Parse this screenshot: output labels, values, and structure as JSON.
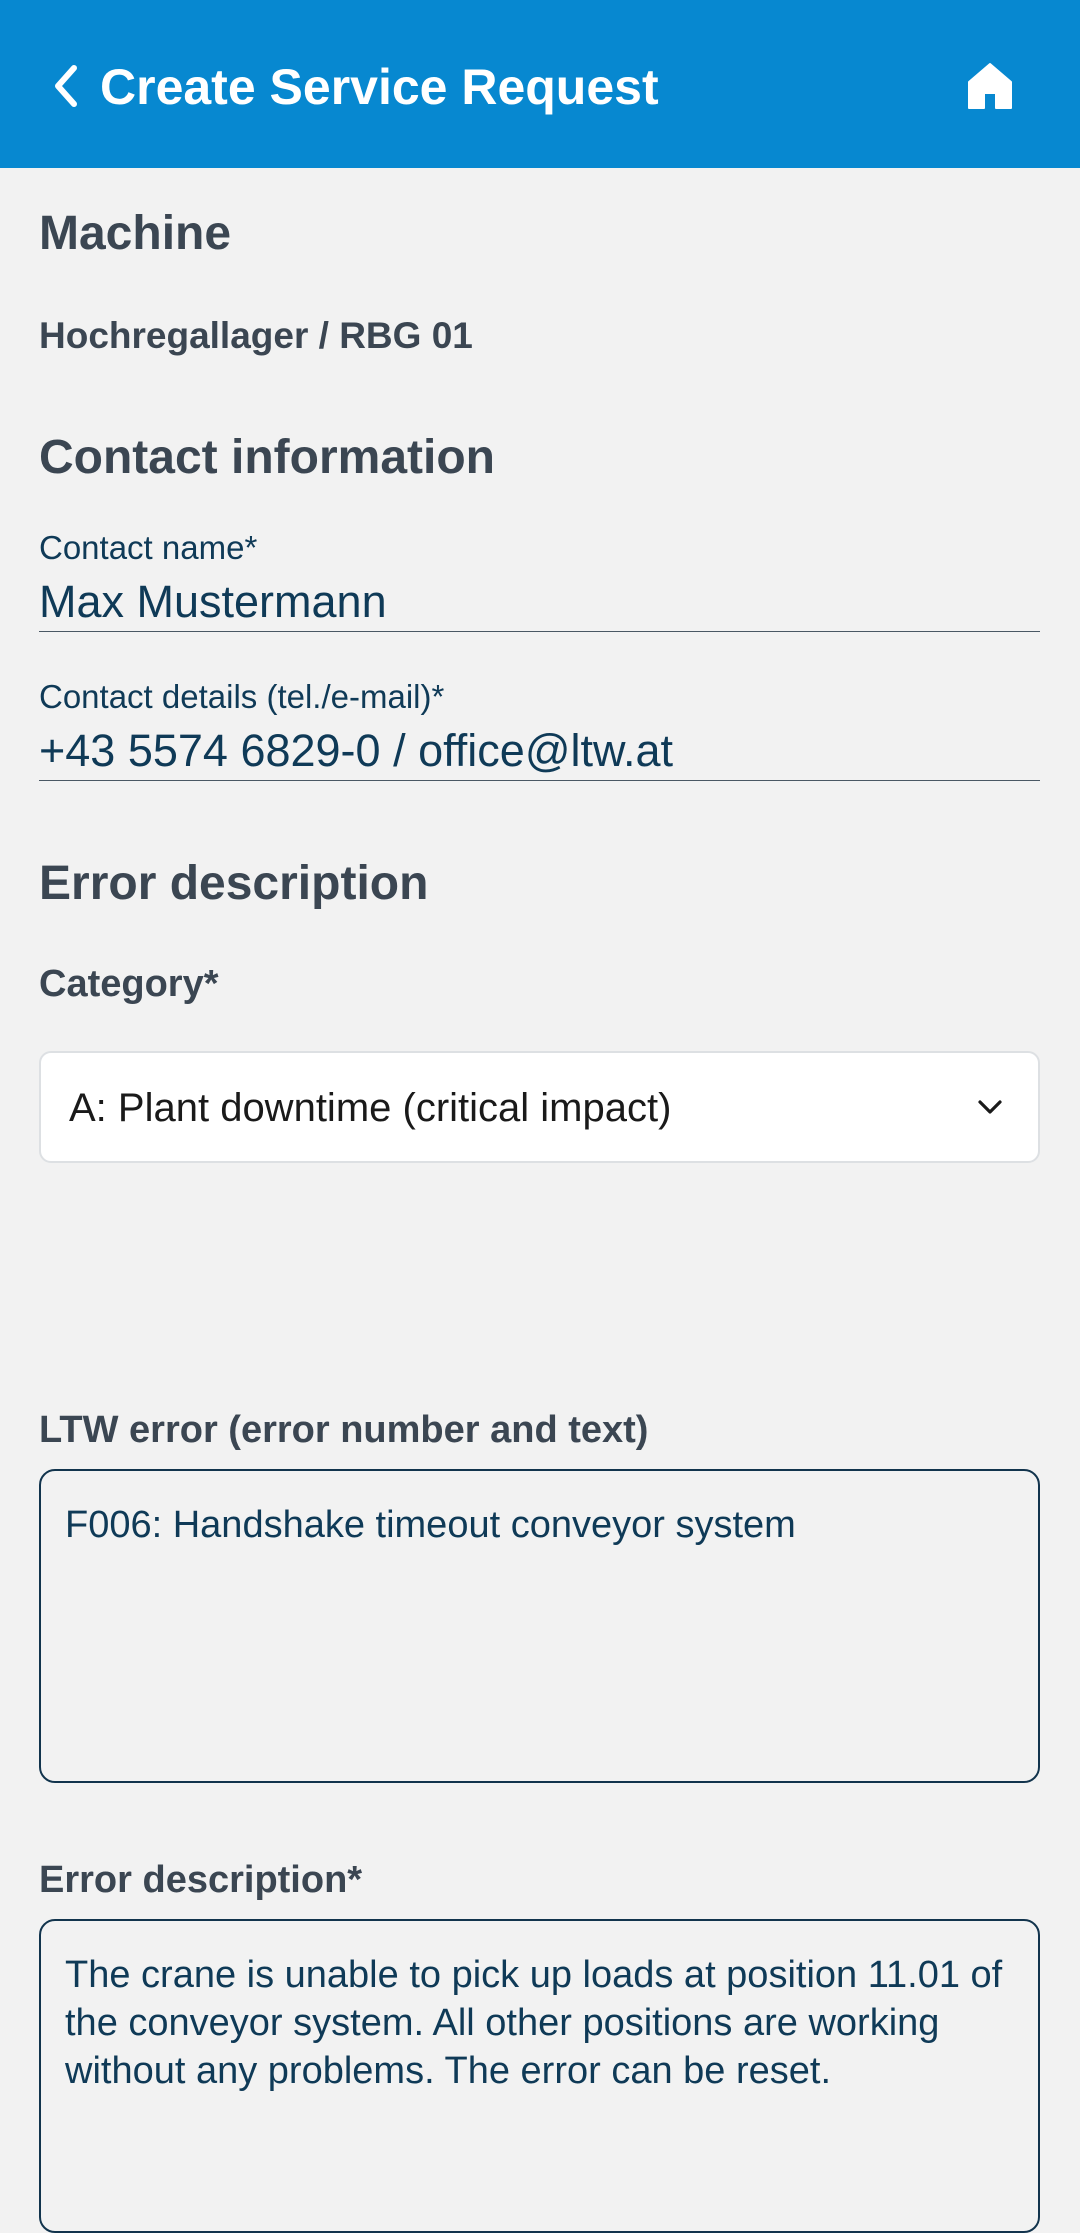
{
  "header": {
    "title": "Create Service Request",
    "back_icon": "chevron-left-icon",
    "home_icon": "home-icon"
  },
  "machine": {
    "heading": "Machine",
    "value": "Hochregallager / RBG 01"
  },
  "contact": {
    "heading": "Contact information",
    "name_label": "Contact name*",
    "name_value": "Max Mustermann",
    "details_label": "Contact details (tel./e-mail)*",
    "details_value": "+43 5574 6829-0 / office@ltw.at"
  },
  "error": {
    "heading": "Error description",
    "category_label": "Category*",
    "category_value": "A: Plant downtime (critical impact)",
    "ltw_error_label": "LTW error (error number and text)",
    "ltw_error_value": "F006: Handshake timeout conveyor system",
    "description_label": "Error description*",
    "description_value": "The crane is unable to pick up loads at position 11.01 of the conveyor system. All other positions are working without any problems. The error can be reset."
  },
  "colors": {
    "appbar": "#0788d0",
    "background": "#f2f2f2",
    "text_dark": "#3b4652",
    "field_text": "#0f3a57"
  }
}
